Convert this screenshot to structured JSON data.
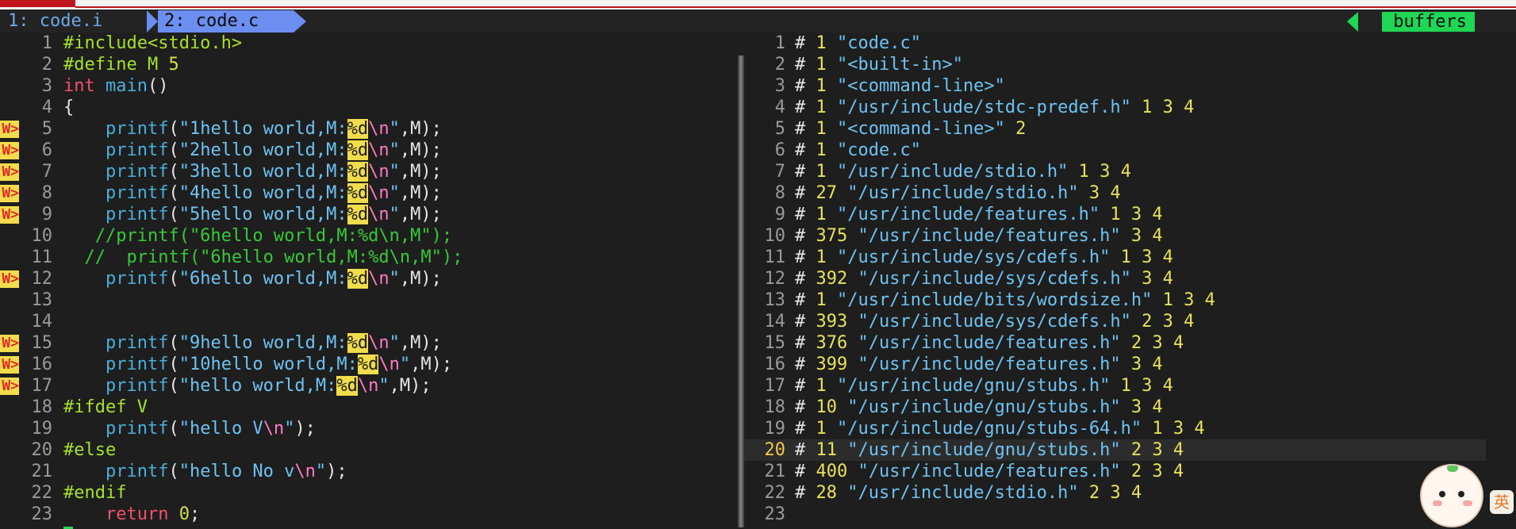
{
  "tabline": {
    "tab1": "1: code.i",
    "tab2": "2: code.c",
    "right_label": "buffers"
  },
  "left": {
    "lines": [
      {
        "n": "1",
        "tokens": [
          [
            "pp",
            "#include<stdio.h>"
          ]
        ]
      },
      {
        "n": "2",
        "tokens": [
          [
            "pp",
            "#define M "
          ],
          [
            "num",
            "5"
          ]
        ]
      },
      {
        "n": "3",
        "tokens": [
          [
            "kw",
            "int"
          ],
          [
            "plain",
            " "
          ],
          [
            "fn",
            "main"
          ],
          [
            "plain",
            "()"
          ]
        ]
      },
      {
        "n": "4",
        "tokens": [
          [
            "plain",
            "{"
          ]
        ]
      },
      {
        "n": "5",
        "sign": "W>",
        "tokens": [
          [
            "plain",
            "    "
          ],
          [
            "fn",
            "printf"
          ],
          [
            "plain",
            "("
          ],
          [
            "str",
            "\"1hello world,M:"
          ],
          [
            "fmt",
            "%d"
          ],
          [
            "esc",
            "\\n"
          ],
          [
            "str",
            "\""
          ],
          [
            "plain",
            ",M);"
          ]
        ]
      },
      {
        "n": "6",
        "sign": "W>",
        "tokens": [
          [
            "plain",
            "    "
          ],
          [
            "fn",
            "printf"
          ],
          [
            "plain",
            "("
          ],
          [
            "str",
            "\"2hello world,M:"
          ],
          [
            "fmt",
            "%d"
          ],
          [
            "esc",
            "\\n"
          ],
          [
            "str",
            "\""
          ],
          [
            "plain",
            ",M);"
          ]
        ]
      },
      {
        "n": "7",
        "sign": "W>",
        "tokens": [
          [
            "plain",
            "    "
          ],
          [
            "fn",
            "printf"
          ],
          [
            "plain",
            "("
          ],
          [
            "str",
            "\"3hello world,M:"
          ],
          [
            "fmt",
            "%d"
          ],
          [
            "esc",
            "\\n"
          ],
          [
            "str",
            "\""
          ],
          [
            "plain",
            ",M);"
          ]
        ]
      },
      {
        "n": "8",
        "sign": "W>",
        "tokens": [
          [
            "plain",
            "    "
          ],
          [
            "fn",
            "printf"
          ],
          [
            "plain",
            "("
          ],
          [
            "str",
            "\"4hello world,M:"
          ],
          [
            "fmt",
            "%d"
          ],
          [
            "esc",
            "\\n"
          ],
          [
            "str",
            "\""
          ],
          [
            "plain",
            ",M);"
          ]
        ]
      },
      {
        "n": "9",
        "sign": "W>",
        "tokens": [
          [
            "plain",
            "    "
          ],
          [
            "fn",
            "printf"
          ],
          [
            "plain",
            "("
          ],
          [
            "str",
            "\"5hello world,M:"
          ],
          [
            "fmt",
            "%d"
          ],
          [
            "esc",
            "\\n"
          ],
          [
            "str",
            "\""
          ],
          [
            "plain",
            ",M);"
          ]
        ]
      },
      {
        "n": "10",
        "tokens": [
          [
            "cmt",
            "   //printf(\"6hello world,M:%d\\n,M\");"
          ]
        ]
      },
      {
        "n": "11",
        "tokens": [
          [
            "cmt",
            "  //  printf(\"6hello world,M:%d\\n,M\");"
          ]
        ]
      },
      {
        "n": "12",
        "sign": "W>",
        "tokens": [
          [
            "plain",
            "    "
          ],
          [
            "fn",
            "printf"
          ],
          [
            "plain",
            "("
          ],
          [
            "str",
            "\"6hello world,M:"
          ],
          [
            "fmt",
            "%d"
          ],
          [
            "esc",
            "\\n"
          ],
          [
            "str",
            "\""
          ],
          [
            "plain",
            ",M);"
          ]
        ]
      },
      {
        "n": "13",
        "tokens": []
      },
      {
        "n": "14",
        "tokens": []
      },
      {
        "n": "15",
        "sign": "W>",
        "tokens": [
          [
            "plain",
            "    "
          ],
          [
            "fn",
            "printf"
          ],
          [
            "plain",
            "("
          ],
          [
            "str",
            "\"9hello world,M:"
          ],
          [
            "fmt",
            "%d"
          ],
          [
            "esc",
            "\\n"
          ],
          [
            "str",
            "\""
          ],
          [
            "plain",
            ",M);"
          ]
        ]
      },
      {
        "n": "16",
        "sign": "W>",
        "tokens": [
          [
            "plain",
            "    "
          ],
          [
            "fn",
            "printf"
          ],
          [
            "plain",
            "("
          ],
          [
            "str",
            "\"10hello world,M:"
          ],
          [
            "fmt",
            "%d"
          ],
          [
            "esc",
            "\\n"
          ],
          [
            "str",
            "\""
          ],
          [
            "plain",
            ",M);"
          ]
        ]
      },
      {
        "n": "17",
        "sign": "W>",
        "tokens": [
          [
            "plain",
            "    "
          ],
          [
            "fn",
            "printf"
          ],
          [
            "plain",
            "("
          ],
          [
            "str",
            "\"hello world,M:"
          ],
          [
            "fmt",
            "%d"
          ],
          [
            "esc",
            "\\n"
          ],
          [
            "str",
            "\""
          ],
          [
            "plain",
            ",M);"
          ]
        ]
      },
      {
        "n": "18",
        "tokens": [
          [
            "pp",
            "#ifdef V"
          ]
        ]
      },
      {
        "n": "19",
        "tokens": [
          [
            "plain",
            "    "
          ],
          [
            "fn",
            "printf"
          ],
          [
            "plain",
            "("
          ],
          [
            "str",
            "\"hello V"
          ],
          [
            "esc",
            "\\n"
          ],
          [
            "str",
            "\""
          ],
          [
            "plain",
            ");"
          ]
        ]
      },
      {
        "n": "20",
        "tokens": [
          [
            "pp",
            "#else"
          ]
        ]
      },
      {
        "n": "21",
        "tokens": [
          [
            "plain",
            "    "
          ],
          [
            "fn",
            "printf"
          ],
          [
            "plain",
            "("
          ],
          [
            "str",
            "\"hello No v"
          ],
          [
            "esc",
            "\\n"
          ],
          [
            "str",
            "\""
          ],
          [
            "plain",
            ");"
          ]
        ]
      },
      {
        "n": "22",
        "tokens": [
          [
            "pp",
            "#endif"
          ]
        ]
      },
      {
        "n": "23",
        "tokens": [
          [
            "plain",
            "    "
          ],
          [
            "kw",
            "return"
          ],
          [
            "plain",
            " "
          ],
          [
            "num",
            "0"
          ],
          [
            "plain",
            ";"
          ]
        ]
      }
    ]
  },
  "right": {
    "current_line": "20",
    "lines": [
      {
        "n": "1",
        "tokens": [
          [
            "hash",
            "# "
          ],
          [
            "flag",
            "1"
          ],
          [
            "plain",
            " "
          ],
          [
            "pstr",
            "\"code.c\""
          ]
        ]
      },
      {
        "n": "2",
        "tokens": [
          [
            "hash",
            "# "
          ],
          [
            "flag",
            "1"
          ],
          [
            "plain",
            " "
          ],
          [
            "pstr",
            "\"<built-in>\""
          ]
        ]
      },
      {
        "n": "3",
        "tokens": [
          [
            "hash",
            "# "
          ],
          [
            "flag",
            "1"
          ],
          [
            "plain",
            " "
          ],
          [
            "pstr",
            "\"<command-line>\""
          ]
        ]
      },
      {
        "n": "4",
        "tokens": [
          [
            "hash",
            "# "
          ],
          [
            "flag",
            "1"
          ],
          [
            "plain",
            " "
          ],
          [
            "pstr",
            "\"/usr/include/stdc-predef.h\""
          ],
          [
            "plain",
            " "
          ],
          [
            "flag",
            "1 3 4"
          ]
        ]
      },
      {
        "n": "5",
        "tokens": [
          [
            "hash",
            "# "
          ],
          [
            "flag",
            "1"
          ],
          [
            "plain",
            " "
          ],
          [
            "pstr",
            "\"<command-line>\""
          ],
          [
            "plain",
            " "
          ],
          [
            "flag",
            "2"
          ]
        ]
      },
      {
        "n": "6",
        "tokens": [
          [
            "hash",
            "# "
          ],
          [
            "flag",
            "1"
          ],
          [
            "plain",
            " "
          ],
          [
            "pstr",
            "\"code.c\""
          ]
        ]
      },
      {
        "n": "7",
        "tokens": [
          [
            "hash",
            "# "
          ],
          [
            "flag",
            "1"
          ],
          [
            "plain",
            " "
          ],
          [
            "pstr",
            "\"/usr/include/stdio.h\""
          ],
          [
            "plain",
            " "
          ],
          [
            "flag",
            "1 3 4"
          ]
        ]
      },
      {
        "n": "8",
        "tokens": [
          [
            "hash",
            "# "
          ],
          [
            "flag",
            "27"
          ],
          [
            "plain",
            " "
          ],
          [
            "pstr",
            "\"/usr/include/stdio.h\""
          ],
          [
            "plain",
            " "
          ],
          [
            "flag",
            "3 4"
          ]
        ]
      },
      {
        "n": "9",
        "tokens": [
          [
            "hash",
            "# "
          ],
          [
            "flag",
            "1"
          ],
          [
            "plain",
            " "
          ],
          [
            "pstr",
            "\"/usr/include/features.h\""
          ],
          [
            "plain",
            " "
          ],
          [
            "flag",
            "1 3 4"
          ]
        ]
      },
      {
        "n": "10",
        "tokens": [
          [
            "hash",
            "# "
          ],
          [
            "flag",
            "375"
          ],
          [
            "plain",
            " "
          ],
          [
            "pstr",
            "\"/usr/include/features.h\""
          ],
          [
            "plain",
            " "
          ],
          [
            "flag",
            "3 4"
          ]
        ]
      },
      {
        "n": "11",
        "tokens": [
          [
            "hash",
            "# "
          ],
          [
            "flag",
            "1"
          ],
          [
            "plain",
            " "
          ],
          [
            "pstr",
            "\"/usr/include/sys/cdefs.h\""
          ],
          [
            "plain",
            " "
          ],
          [
            "flag",
            "1 3 4"
          ]
        ]
      },
      {
        "n": "12",
        "tokens": [
          [
            "hash",
            "# "
          ],
          [
            "flag",
            "392"
          ],
          [
            "plain",
            " "
          ],
          [
            "pstr",
            "\"/usr/include/sys/cdefs.h\""
          ],
          [
            "plain",
            " "
          ],
          [
            "flag",
            "3 4"
          ]
        ]
      },
      {
        "n": "13",
        "tokens": [
          [
            "hash",
            "# "
          ],
          [
            "flag",
            "1"
          ],
          [
            "plain",
            " "
          ],
          [
            "pstr",
            "\"/usr/include/bits/wordsize.h\""
          ],
          [
            "plain",
            " "
          ],
          [
            "flag",
            "1 3 4"
          ]
        ]
      },
      {
        "n": "14",
        "tokens": [
          [
            "hash",
            "# "
          ],
          [
            "flag",
            "393"
          ],
          [
            "plain",
            " "
          ],
          [
            "pstr",
            "\"/usr/include/sys/cdefs.h\""
          ],
          [
            "plain",
            " "
          ],
          [
            "flag",
            "2 3 4"
          ]
        ]
      },
      {
        "n": "15",
        "tokens": [
          [
            "hash",
            "# "
          ],
          [
            "flag",
            "376"
          ],
          [
            "plain",
            " "
          ],
          [
            "pstr",
            "\"/usr/include/features.h\""
          ],
          [
            "plain",
            " "
          ],
          [
            "flag",
            "2 3 4"
          ]
        ]
      },
      {
        "n": "16",
        "tokens": [
          [
            "hash",
            "# "
          ],
          [
            "flag",
            "399"
          ],
          [
            "plain",
            " "
          ],
          [
            "pstr",
            "\"/usr/include/features.h\""
          ],
          [
            "plain",
            " "
          ],
          [
            "flag",
            "3 4"
          ]
        ]
      },
      {
        "n": "17",
        "tokens": [
          [
            "hash",
            "# "
          ],
          [
            "flag",
            "1"
          ],
          [
            "plain",
            " "
          ],
          [
            "pstr",
            "\"/usr/include/gnu/stubs.h\""
          ],
          [
            "plain",
            " "
          ],
          [
            "flag",
            "1 3 4"
          ]
        ]
      },
      {
        "n": "18",
        "tokens": [
          [
            "hash",
            "# "
          ],
          [
            "flag",
            "10"
          ],
          [
            "plain",
            " "
          ],
          [
            "pstr",
            "\"/usr/include/gnu/stubs.h\""
          ],
          [
            "plain",
            " "
          ],
          [
            "flag",
            "3 4"
          ]
        ]
      },
      {
        "n": "19",
        "tokens": [
          [
            "hash",
            "# "
          ],
          [
            "flag",
            "1"
          ],
          [
            "plain",
            " "
          ],
          [
            "pstr",
            "\"/usr/include/gnu/stubs-64.h\""
          ],
          [
            "plain",
            " "
          ],
          [
            "flag",
            "1 3 4"
          ]
        ]
      },
      {
        "n": "20",
        "tokens": [
          [
            "hash",
            "# "
          ],
          [
            "flag",
            "11"
          ],
          [
            "plain",
            " "
          ],
          [
            "pstr",
            "\"/usr/include/gnu/stubs.h\""
          ],
          [
            "plain",
            " "
          ],
          [
            "flag",
            "2 3 4"
          ]
        ]
      },
      {
        "n": "21",
        "tokens": [
          [
            "hash",
            "# "
          ],
          [
            "flag",
            "400"
          ],
          [
            "plain",
            " "
          ],
          [
            "pstr",
            "\"/usr/include/features.h\""
          ],
          [
            "plain",
            " "
          ],
          [
            "flag",
            "2 3 4"
          ]
        ]
      },
      {
        "n": "22",
        "tokens": [
          [
            "hash",
            "# "
          ],
          [
            "flag",
            "28"
          ],
          [
            "plain",
            " "
          ],
          [
            "pstr",
            "\"/usr/include/stdio.h\""
          ],
          [
            "plain",
            " "
          ],
          [
            "flag",
            "2 3 4"
          ]
        ]
      },
      {
        "n": "23",
        "tokens": []
      }
    ]
  },
  "overlay": {
    "ime_label": "英"
  },
  "colors": {
    "background": "#1e1e1e",
    "active_tab": "#6b8ef0",
    "buffers_label_bg": "#1fd655",
    "warning_sign_bg": "#f1dc4b",
    "warning_sign_fg": "#e02a2a"
  }
}
